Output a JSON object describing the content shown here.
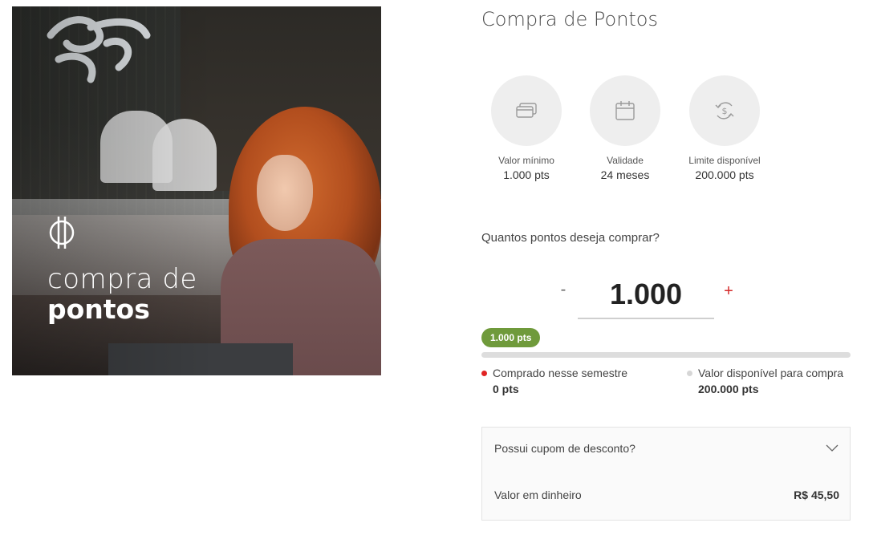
{
  "hero": {
    "caption_line1": "compra de",
    "caption_line2": "pontos"
  },
  "page_title": "Compra de Pontos",
  "info_cards": [
    {
      "icon": "cards-icon",
      "label": "Valor mínimo",
      "value": "1.000 pts"
    },
    {
      "icon": "calendar-icon",
      "label": "Validade",
      "value": "24 meses"
    },
    {
      "icon": "dollar-exchange-icon",
      "label": "Limite disponível",
      "value": "200.000 pts"
    }
  ],
  "question": "Quantos pontos deseja comprar?",
  "quantity": {
    "minus_label": "-",
    "value": "1.000",
    "plus_label": "+"
  },
  "progress": {
    "badge": "1.000 pts",
    "purchased_fraction": 0.0
  },
  "legend": [
    {
      "label": "Comprado nesse semestre",
      "value": "0 pts",
      "color": "#e02424"
    },
    {
      "label": "Valor disponível para compra",
      "value": "200.000 pts",
      "color": "#d6d6d6"
    }
  ],
  "coupon": {
    "label": "Possui cupom de desconto?"
  },
  "cash": {
    "label": "Valor em dinheiro",
    "amount": "R$ 45,50"
  },
  "colors": {
    "accent_red": "#e02424",
    "badge_green": "#6f9a3b"
  }
}
